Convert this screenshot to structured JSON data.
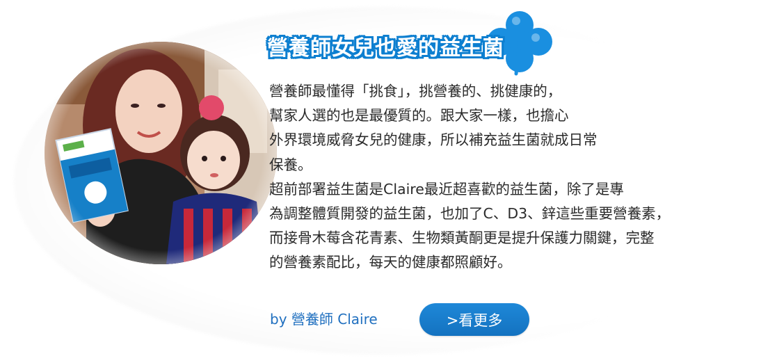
{
  "title": "營養師女兒也愛的益生菌",
  "body_lines": [
    "營養師最懂得「挑食」，挑營養的、挑健康的，",
    "幫家人選的也是最優質的。跟大家一樣，也擔心",
    "外界環境威脅女兒的健康，所以補充益生菌就成日常",
    "保養。",
    "超前部署益生菌是Claire最近超喜歡的益生菌，除了是專",
    "為調整體質開發的益生菌，也加了C、D3、鋅這些重要營養素，",
    "而接骨木莓含花青素、生物類黃酮更是提升保護力關鍵，完整",
    "的營養素配比，每天的健康都照顧好。"
  ],
  "byline": "by 營養師 Claire",
  "more_button_label": ">看更多",
  "colors": {
    "accent_blue": "#1472c0",
    "title_outline": "#0d7fd0",
    "clover": "#1a8fe0",
    "byline": "#1f6fbf"
  },
  "icons": {
    "title_decoration": "clover-icon"
  }
}
